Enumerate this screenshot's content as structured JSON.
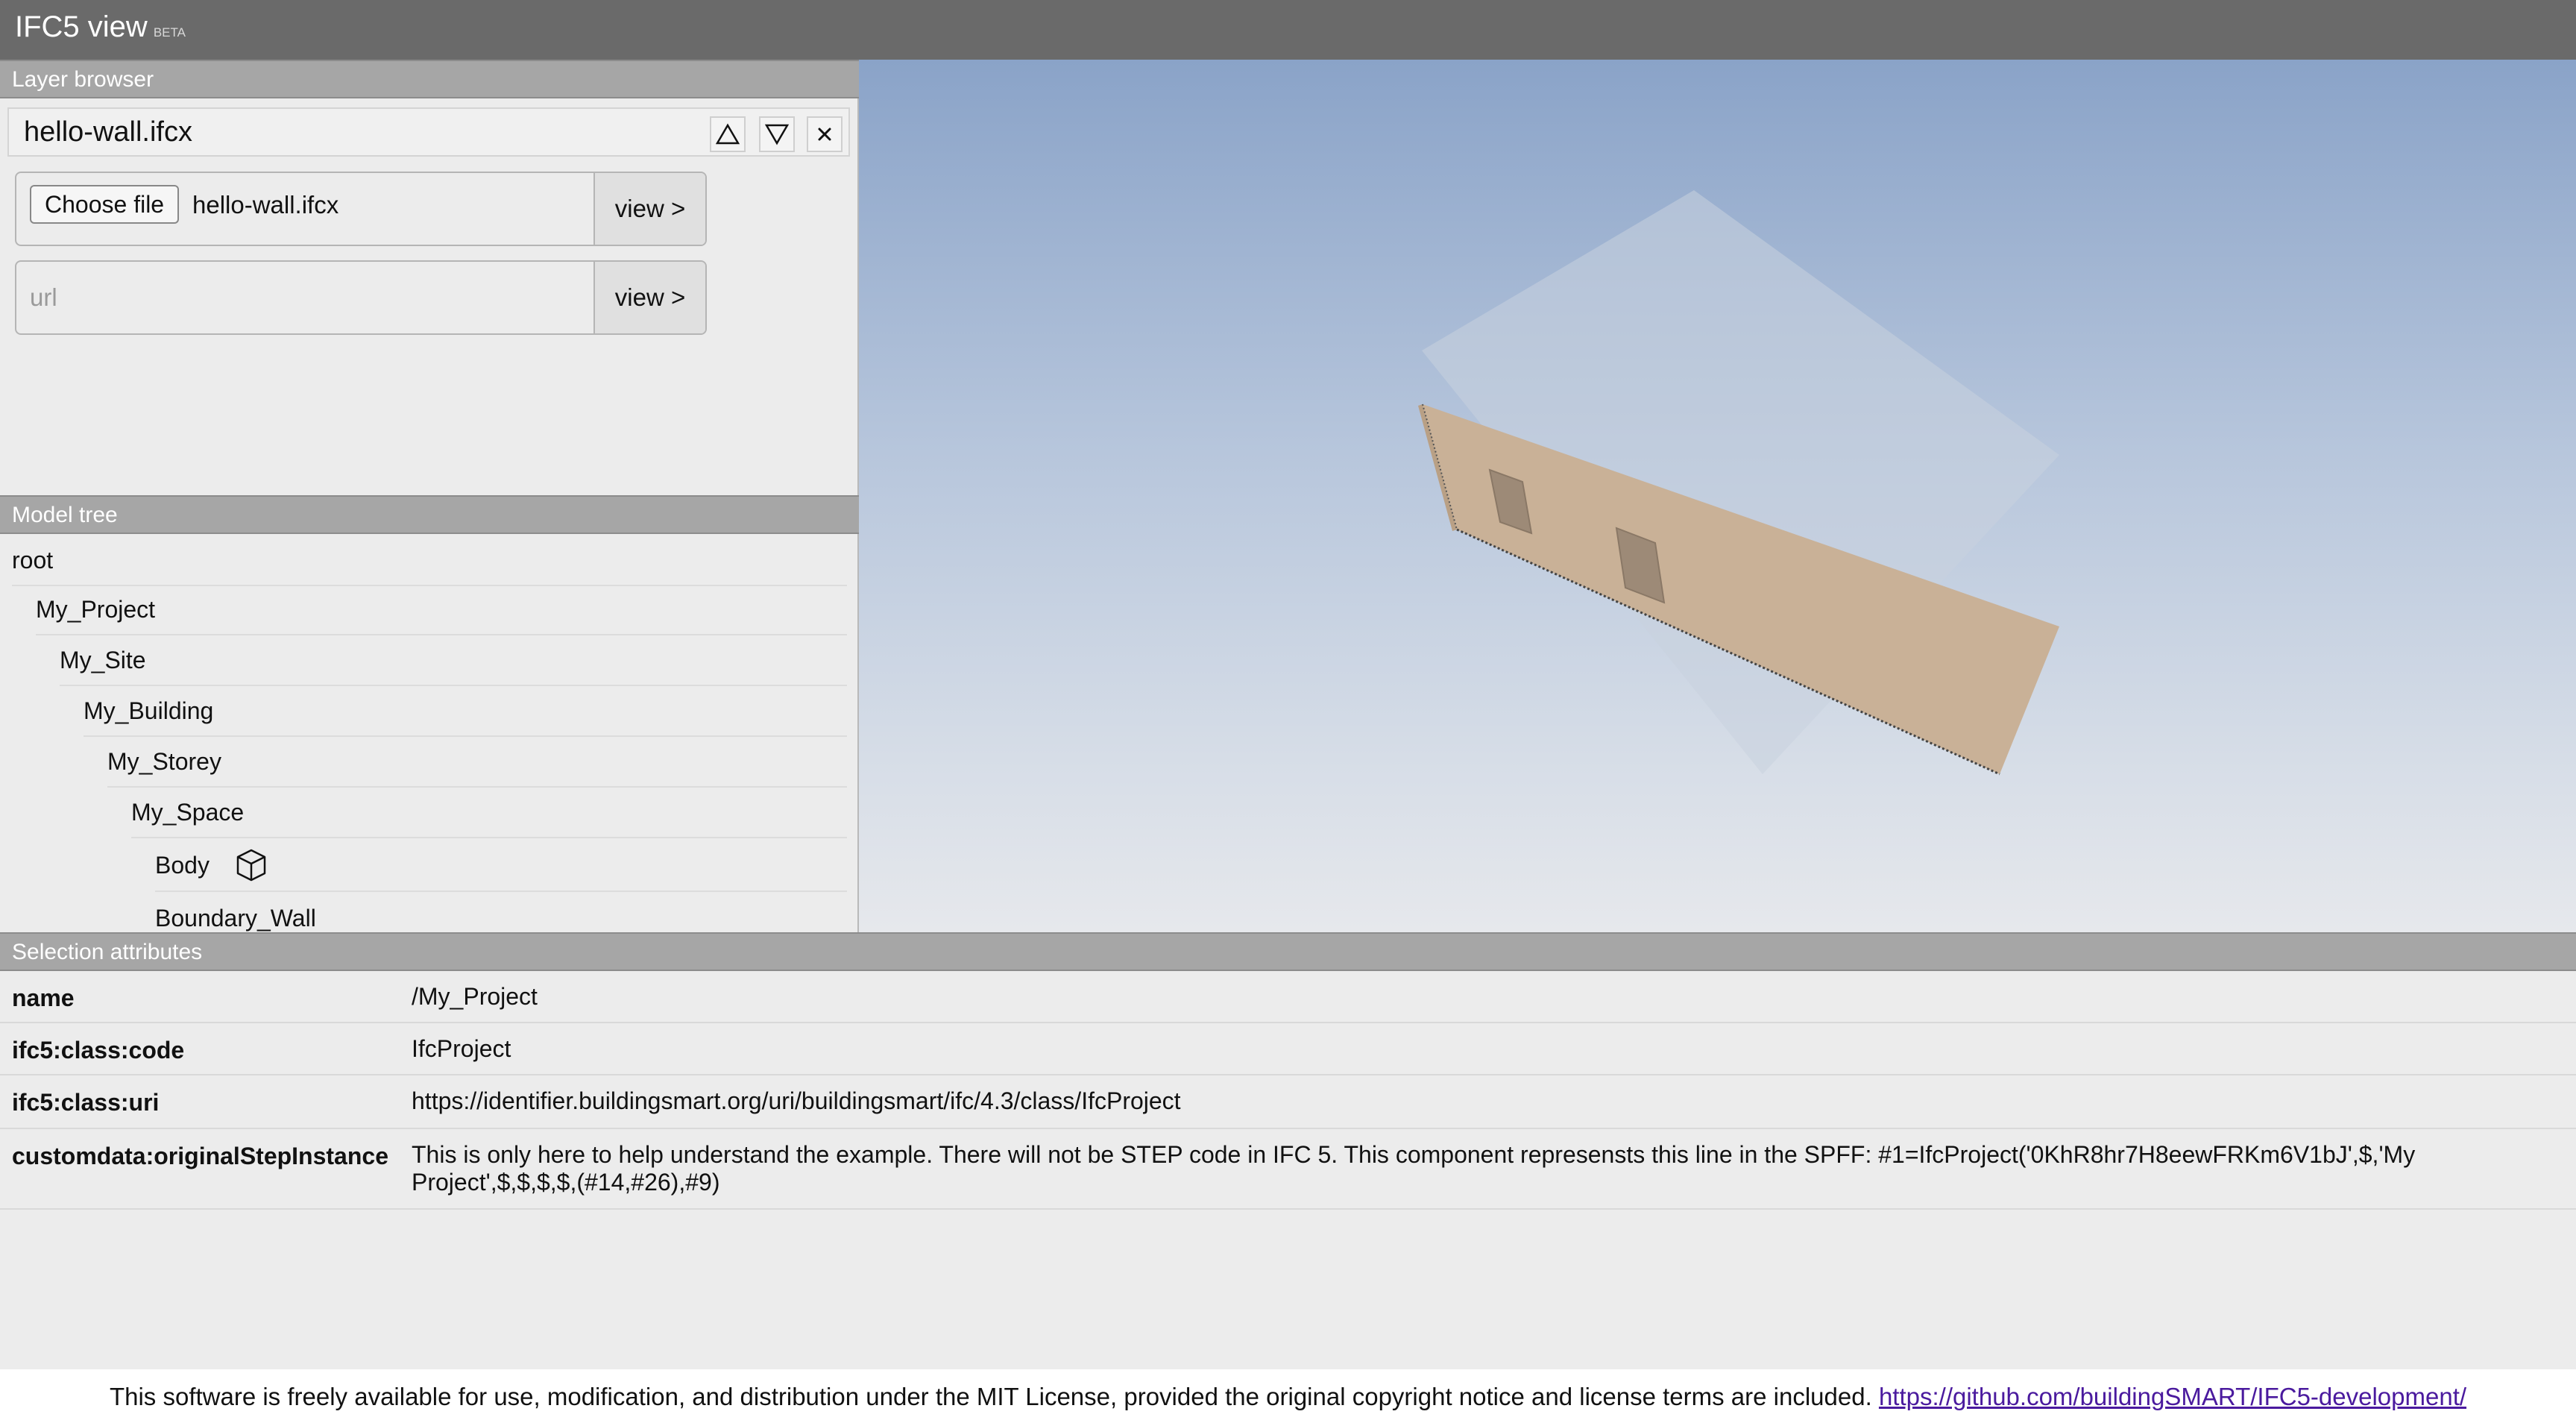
{
  "app": {
    "title": "IFC5 view",
    "badge": "BETA"
  },
  "layer_browser": {
    "header": "Layer browser",
    "layer_name": "hello-wall.ifcx",
    "file_input": {
      "button_label": "Choose file",
      "file_name": "hello-wall.ifcx",
      "view_label": "view >"
    },
    "url_input": {
      "placeholder": "url",
      "value": "",
      "view_label": "view >"
    }
  },
  "model_tree": {
    "header": "Model tree",
    "items": [
      {
        "label": "root"
      },
      {
        "label": "My_Project"
      },
      {
        "label": "My_Site"
      },
      {
        "label": "My_Building"
      },
      {
        "label": "My_Storey"
      },
      {
        "label": "My_Space"
      },
      {
        "label": "Body",
        "icon": "cube-icon"
      },
      {
        "label": "Boundary_Wall"
      }
    ]
  },
  "selection_attributes": {
    "header": "Selection attributes",
    "rows": [
      {
        "key": "name",
        "value": "/My_Project"
      },
      {
        "key": "ifc5:class:code",
        "value": "IfcProject"
      },
      {
        "key": "ifc5:class:uri",
        "value": "https://identifier.buildingsmart.org/uri/buildingsmart/ifc/4.3/class/IfcProject"
      },
      {
        "key": "customdata:originalStepInstance",
        "value": "This is only here to help understand the example. There will not be STEP code in IFC 5. This component represensts this line in the SPFF: #1=IfcProject('0KhR8hr7H8eewFRKm6V1bJ',$,'My Project',$,$,$,$,(#14,#26),#9)"
      }
    ]
  },
  "footer": {
    "text": "This software is freely available for use, modification, and distribution under the MIT License, provided the original copyright notice and license terms are included.",
    "link": "https://github.com/buildingSMART/IFC5-development/"
  },
  "colors": {
    "titlebar": "#6a6a6a",
    "panel_header": "#a6a6a6",
    "wall": "#c9b197",
    "link": "#4a1a9e"
  }
}
